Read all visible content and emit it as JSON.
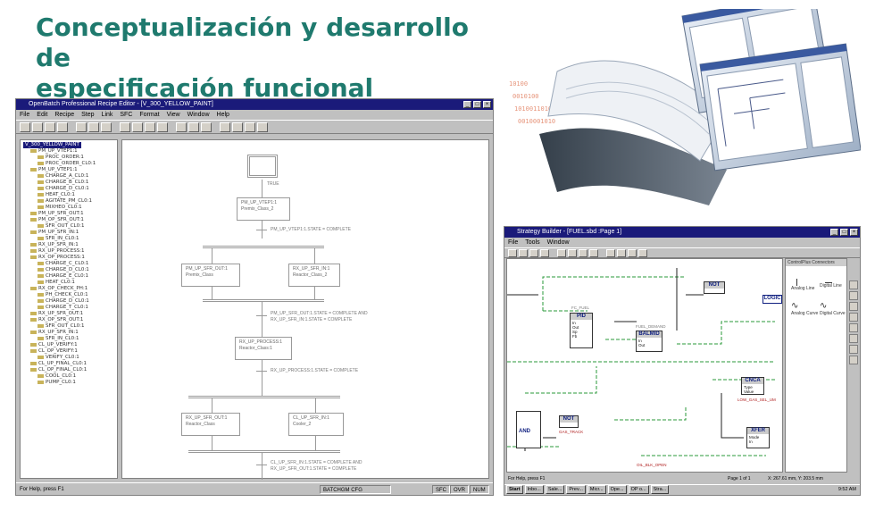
{
  "slide": {
    "title_line1": "Conceptualización y desarrollo de",
    "title_line2": "especificación funcional"
  },
  "recipe_editor": {
    "window_title": "OpenBatch Professional Recipe Editor - [V_300_YELLOW_PAINT]",
    "menu": [
      "File",
      "Edit",
      "Recipe",
      "Step",
      "Link",
      "SFC",
      "Format",
      "View",
      "Window",
      "Help"
    ],
    "tree": {
      "root": "V_300_YELLOW_PAINT",
      "nodes": [
        "PM_UP_VTEP1:1",
        "PROC_ORDER:1",
        "PROC_ORDER_CL0:1",
        "PM_UP_VTEP1:1",
        "CHARGE_A_CL0:1",
        "CHARGE_B_CL0:1",
        "CHARGE_D_CL0:1",
        "HEAT_CL0:1",
        "AGITATE_PM_CL0:1",
        "MIXHEO_CL0:1",
        "PM_UP_SFR_OUT:1",
        "PM_OP_SFR_OUT:1",
        "SFR_OUT_CL0:1",
        "PM_UP_SFR_IN:1",
        "SFR_IN_CL0:1",
        "RX_UP_SFR_IN:1",
        "RX_UP_PROCESS:1",
        "RX_OP_PROCESS:1",
        "CHARGE_C_CL0:1",
        "CHARGE_D_CL0:1",
        "CHARGE_E_CL0:1",
        "HEAT_CL0:1",
        "RX_OP_CHECK_PH:1",
        "PH_CHECK_CL0:1",
        "CHARGE_D_CL0:1",
        "CHARGE_T_CL0:1",
        "RX_UP_SFR_OUT:1",
        "RX_OP_SFR_OUT:1",
        "SFR_OUT_CL0:1",
        "RX_UP_SFR_IN:1",
        "SFR_IN_CL0:1",
        "CL_UP_VERIFY:1",
        "CL_OP_VERIFY:1",
        "VERIFY_CL0:1",
        "CL_UP_FINAL_CL0:1",
        "CL_OP_FINAL_CL0:1",
        "COOL_CL0:1",
        "PUMP_CL0:1"
      ]
    },
    "sfc": {
      "start_label": "TRUE",
      "step1_name": "PM_UP_VTEP1:1",
      "step1_sub": "Premix_Class_2",
      "trans1": "PM_UP_VTEP1:1.STATE = COMPLETE",
      "step2a_name": "PM_UP_SFR_OUT:1",
      "step2a_sub": "Premix_Class",
      "step2b_name": "RX_UP_SFR_IN:1",
      "step2b_sub": "Reactor_Class_2",
      "trans2a": "PM_UP_SFR_OUT:1.STATE = COMPLETE AND",
      "trans2b": "RX_UP_SFR_IN:1.STATE = COMPLETE",
      "step3_name": "RX_UP_PROCESS:1",
      "step3_sub": "Reactor_Class:1",
      "trans3": "RX_UP_PROCESS:1.STATE = COMPLETE",
      "step4a_name": "RX_UP_SFR_OUT:1",
      "step4a_sub": "Reactor_Class",
      "step4b_name": "CL_UP_SFR_IN:1",
      "step4b_sub": "Cooler_2",
      "trans4a": "CL_UP_SFR_IN:1.STATE = COMPLETE AND",
      "trans4b": "RX_UP_SFR_OUT:1.STATE = COMPLETE"
    },
    "status_text": "For Help, press F1",
    "status_cells": [
      "BATCHGM CFG",
      "SFC",
      "OVR",
      "NUM"
    ]
  },
  "strategy_builder": {
    "window_title": "Strategy Builder - [FUEL.sbd :Page 1]",
    "menu": [
      "File",
      "Tools",
      "Window"
    ],
    "palette_title": "ControlPlus Connectors",
    "palette_items": [
      "Analog Line",
      "Digital Line",
      "Analog Curve",
      "Digital Curve"
    ],
    "blocks": {
      "pid_tag": "FC_FUEL",
      "pid": "PID",
      "balmd": "BALMID",
      "balmd_tag": "FUEL_DEMAND",
      "not1": "NOT",
      "logic": "LOGIC",
      "cnca": "CNCA",
      "cnca_tag": "LOW_GAS_SEL_UM",
      "xfer": "XFER",
      "and": "AND",
      "not2": "NOT",
      "not2_tag": "GAS_TRACK",
      "bottom_tag": "OIL_BLK_OPEN"
    },
    "status_text": "For Help, press F1",
    "status_page": "Page 1 of 1",
    "status_coords": "X: 267.61 mm, Y: 203.5 mm",
    "taskbar_items": [
      "Start",
      "Inbo...",
      "Sale...",
      "Prev...",
      "Micr...",
      "Ope...",
      "OP o...",
      "Stra..."
    ],
    "clock": "9:52 AM"
  }
}
